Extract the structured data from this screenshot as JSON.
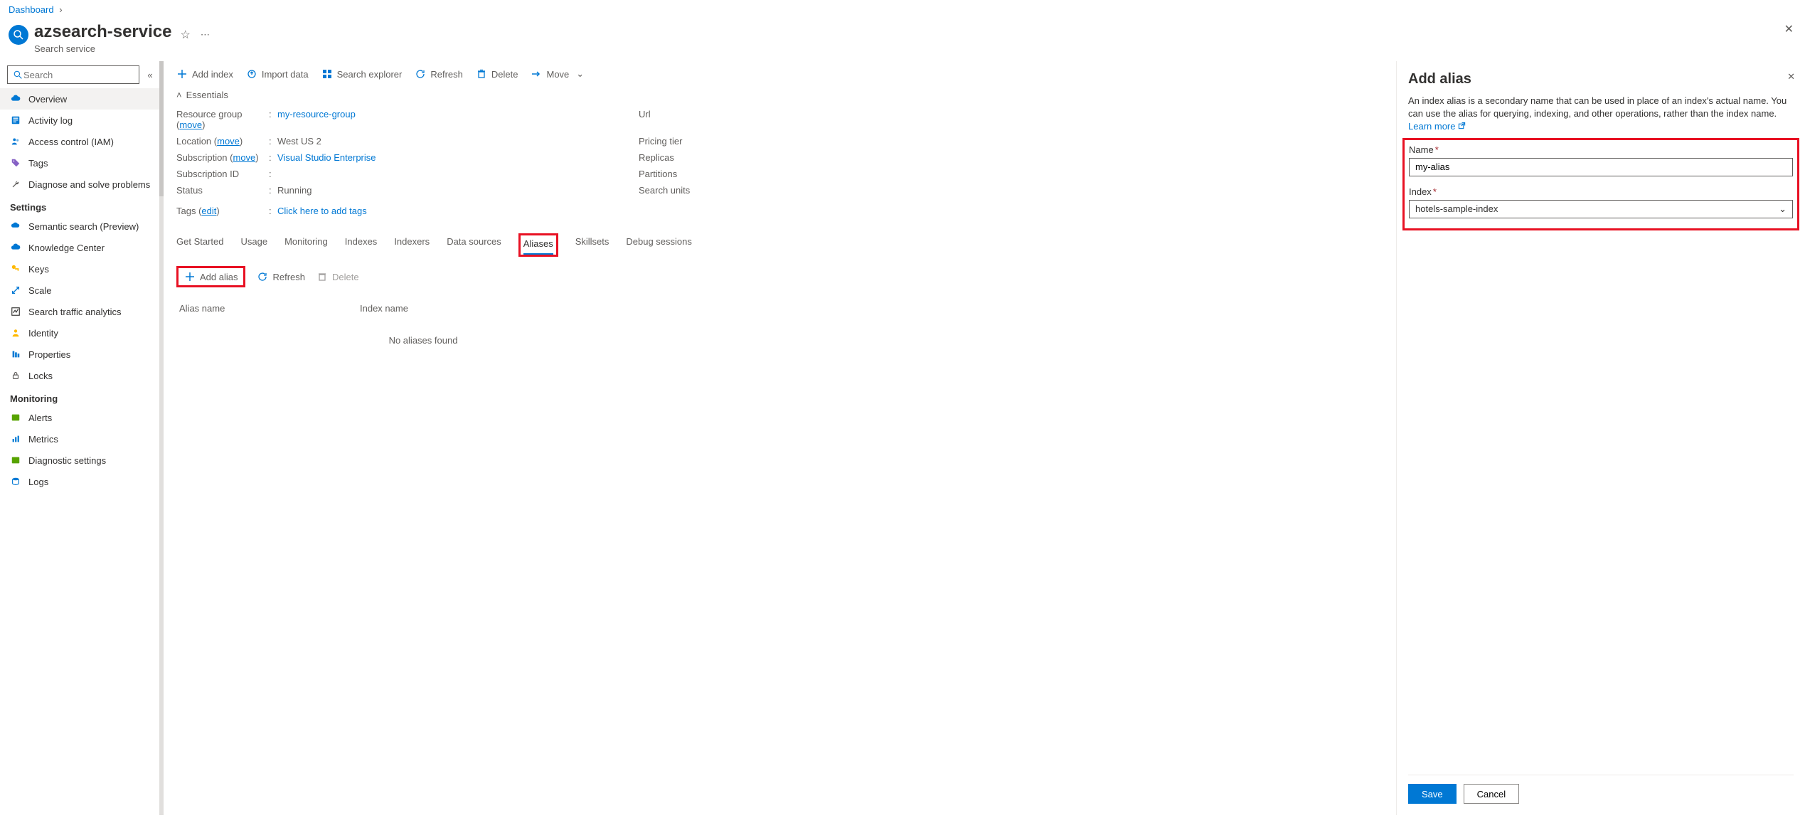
{
  "breadcrumb": {
    "root": "Dashboard"
  },
  "header": {
    "title": "azsearch-service",
    "subtitle": "Search service"
  },
  "sidebar": {
    "search_placeholder": "Search",
    "items": [
      "Overview",
      "Activity log",
      "Access control (IAM)",
      "Tags",
      "Diagnose and solve problems"
    ],
    "settings_label": "Settings",
    "settings_items": [
      "Semantic search (Preview)",
      "Knowledge Center",
      "Keys",
      "Scale",
      "Search traffic analytics",
      "Identity",
      "Properties",
      "Locks"
    ],
    "monitoring_label": "Monitoring",
    "monitoring_items": [
      "Alerts",
      "Metrics",
      "Diagnostic settings",
      "Logs"
    ]
  },
  "cmdbar": {
    "add_index": "Add index",
    "import_data": "Import data",
    "search_explorer": "Search explorer",
    "refresh": "Refresh",
    "delete": "Delete",
    "move": "Move"
  },
  "essentials": {
    "title": "Essentials",
    "resource_group_label": "Resource group",
    "move_link": "move",
    "resource_group_value": "my-resource-group",
    "location_label": "Location",
    "location_value": "West US 2",
    "subscription_label": "Subscription",
    "subscription_value": "Visual Studio Enterprise",
    "subscription_id_label": "Subscription ID",
    "subscription_id_value": "",
    "status_label": "Status",
    "status_value": "Running",
    "right": {
      "url": "Url",
      "pricing_tier": "Pricing tier",
      "replicas": "Replicas",
      "partitions": "Partitions",
      "search_units": "Search units"
    },
    "tags_label": "Tags",
    "tags_edit": "edit",
    "tags_placeholder": "Click here to add tags"
  },
  "tabs": [
    "Get Started",
    "Usage",
    "Monitoring",
    "Indexes",
    "Indexers",
    "Data sources",
    "Aliases",
    "Skillsets",
    "Debug sessions"
  ],
  "subcmd": {
    "add_alias": "Add alias",
    "refresh": "Refresh",
    "delete": "Delete"
  },
  "table": {
    "alias_name": "Alias name",
    "index_name": "Index name",
    "empty": "No aliases found"
  },
  "panel": {
    "title": "Add alias",
    "desc": "An index alias is a secondary name that can be used in place of an index's actual name. You can use the alias for querying, indexing, and other operations, rather than the index name.",
    "learn_more": "Learn more",
    "name_label": "Name",
    "name_value": "my-alias",
    "index_label": "Index",
    "index_value": "hotels-sample-index",
    "save": "Save",
    "cancel": "Cancel"
  }
}
